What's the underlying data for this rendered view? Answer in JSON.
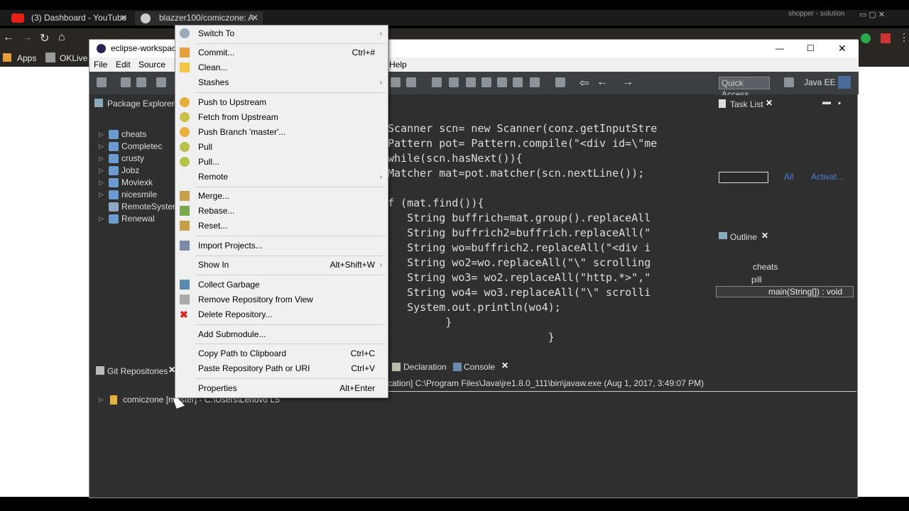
{
  "browser": {
    "tabs": [
      {
        "title": "(3) Dashboard - YouTube"
      },
      {
        "title": "blazzer100/comiczone: A"
      }
    ],
    "bookmarks": [
      "Apps",
      "OKLive"
    ],
    "profile": "shopper - solution"
  },
  "eclipse": {
    "title": "eclipse-workspace",
    "menus": [
      "File",
      "Edit",
      "Source",
      "Help"
    ],
    "quick_access": "Quick Access",
    "perspective": "Java EE",
    "package_explorer": {
      "title": "Package Explorer",
      "projects": [
        "cheats",
        "Completec",
        "crusty",
        "Jobz",
        "Moviexk",
        "nicesmile",
        "RemoteSystem",
        "Renewal"
      ]
    },
    "code_lines": [
      "Scanner scn= new Scanner(conz.getInputStre",
      "Pattern pot= Pattern.compile(\"<div id=\\\"me",
      "while(scn.hasNext()){",
      "Matcher mat=pot.matcher(scn.nextLine());",
      "",
      "f (mat.find()){",
      "   String buffrich=mat.group().replaceAll",
      "   String buffrich2=buffrich.replaceAll(\"",
      "   String wo=buffrich2.replaceAll(\"<div i",
      "   String wo2=wo.replaceAll(\"\\\" scrolling",
      "   String wo3= wo2.replaceAll(\"http.*>\",\"",
      "   String wo4= wo3.replaceAll(\"\\\" scrolli",
      "   System.out.println(wo4);",
      "         }",
      "                         }"
    ],
    "task_list": {
      "title": "Task List",
      "filter_all": "All",
      "filter_activate": "Activat..."
    },
    "outline": {
      "title": "Outline",
      "items": [
        "cheats",
        "pill",
        "main(String[]) : void"
      ]
    },
    "bottom_tabs": [
      "Declaration",
      "Console"
    ],
    "console_line": "cation] C:\\Program Files\\Java\\jre1.8.0_111\\bin\\javaw.exe (Aug 1, 2017, 3:49:07 PM)",
    "git_repos": {
      "title": "Git Repositories",
      "repo": "comiczone [master] - C:\\Users\\Lenovo L510"
    }
  },
  "context_menu": {
    "items": [
      {
        "label": "Switch To",
        "shortcut": "",
        "submenu": true
      },
      {
        "label": "Commit...",
        "shortcut": "Ctrl+#",
        "submenu": false
      },
      {
        "label": "Clean...",
        "shortcut": "",
        "submenu": false
      },
      {
        "label": "Stashes",
        "shortcut": "",
        "submenu": true
      },
      {
        "label": "Push to Upstream",
        "shortcut": "",
        "submenu": false
      },
      {
        "label": "Fetch from Upstream",
        "shortcut": "",
        "submenu": false
      },
      {
        "label": "Push Branch 'master'...",
        "shortcut": "",
        "submenu": false
      },
      {
        "label": "Pull",
        "shortcut": "",
        "submenu": false
      },
      {
        "label": "Pull...",
        "shortcut": "",
        "submenu": false
      },
      {
        "label": "Remote",
        "shortcut": "",
        "submenu": true
      },
      {
        "label": "Merge...",
        "shortcut": "",
        "submenu": false
      },
      {
        "label": "Rebase...",
        "shortcut": "",
        "submenu": false
      },
      {
        "label": "Reset...",
        "shortcut": "",
        "submenu": false
      },
      {
        "label": "Import Projects...",
        "shortcut": "",
        "submenu": false
      },
      {
        "label": "Show In",
        "shortcut": "Alt+Shift+W",
        "submenu": true
      },
      {
        "label": "Collect Garbage",
        "shortcut": "",
        "submenu": false
      },
      {
        "label": "Remove Repository from View",
        "shortcut": "",
        "submenu": false
      },
      {
        "label": "Delete Repository...",
        "shortcut": "",
        "submenu": false
      },
      {
        "label": "Add Submodule...",
        "shortcut": "",
        "submenu": false
      },
      {
        "label": "Copy Path to Clipboard",
        "shortcut": "Ctrl+C",
        "submenu": false
      },
      {
        "label": "Paste Repository Path or URI",
        "shortcut": "Ctrl+V",
        "submenu": false
      },
      {
        "label": "Properties",
        "shortcut": "Alt+Enter",
        "submenu": false
      }
    ],
    "submenu_arrow": "›"
  }
}
